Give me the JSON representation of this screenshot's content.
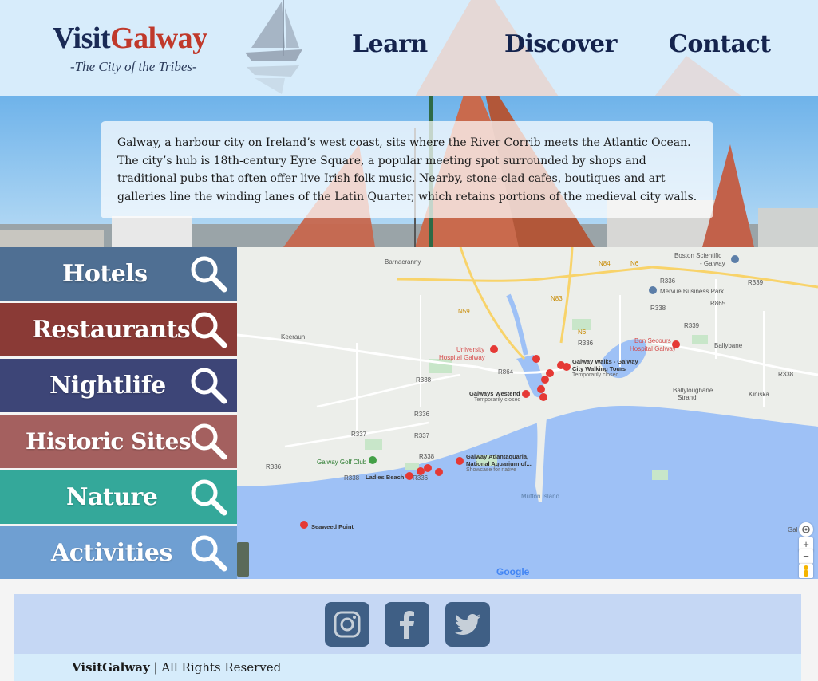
{
  "header": {
    "logo_part1": "Visit",
    "logo_part2": "Galway",
    "tagline": "-The City of the Tribes-",
    "nav": [
      "Learn",
      "Discover",
      "Contact"
    ]
  },
  "intro": {
    "text": "Galway, a harbour city on Ireland’s west coast, sits where the River Corrib meets the Atlantic Ocean. The city’s hub is 18th-century Eyre Square, a popular meeting spot surrounded by shops and traditional pubs that often offer live Irish folk music. Nearby, stone-clad cafes, boutiques and art galleries line the winding lanes of the Latin Quarter, which retains portions of the medieval city walls."
  },
  "categories": [
    {
      "label": "Hotels",
      "color": "#4f6f93"
    },
    {
      "label": "Restaurants",
      "color": "#8a3a36"
    },
    {
      "label": "Nightlife",
      "color": "#3d4577"
    },
    {
      "label": "Historic Sites",
      "color": "#a4605f"
    },
    {
      "label": "Nature",
      "color": "#34a89a"
    },
    {
      "label": "Activities",
      "color": "#6f9fd2"
    }
  ],
  "map": {
    "labels": {
      "barnacranny": "Barnacranny",
      "boston": "Boston Scientific",
      "boston_sub": "- Galway",
      "mervue": "Mervue Business Park",
      "ballybane": "Ballybane",
      "keeraun": "Keeraun",
      "uhg": "University",
      "uhg2": "Hospital Galway",
      "bon_secours": "Bon Secours",
      "bon_secours2": "Hospital Galway",
      "walks": "Galway Walks - Galway",
      "walks2": "City Walking Tours",
      "walks3": "Temporarily closed",
      "westend": "Galways Westend",
      "westend2": "Temporarily closed",
      "ballyloughane": "Ballyloughane",
      "ballyloughane2": "Strand",
      "kiniska": "Kiniska",
      "golf": "Galway Golf Club",
      "aquarium": "Galway Atlantaquaria,",
      "aquarium2": "National Aquarium of...",
      "aquarium3": "Showcase for native",
      "ladies": "Ladies Beach",
      "mutton": "Mutton Island",
      "seaweed": "Seaweed Point",
      "google": "Google",
      "gal": "Gal"
    },
    "road_labels": [
      "N84",
      "N6",
      "N59",
      "N83",
      "N6",
      "R338",
      "R336",
      "R339",
      "R865",
      "R339",
      "R338",
      "R336",
      "R338",
      "R864",
      "R337",
      "R336",
      "R337",
      "R338",
      "R336",
      "R338",
      "R336"
    ],
    "zoom_in": "+",
    "zoom_out": "−"
  },
  "footer": {
    "social": [
      "instagram",
      "facebook",
      "twitter"
    ],
    "brand": "VisitGalway",
    "rights": " | All Rights Reserved"
  }
}
